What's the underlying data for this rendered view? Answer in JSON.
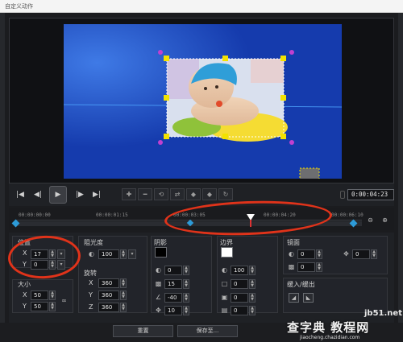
{
  "window": {
    "title": "自定义动作"
  },
  "preview": {
    "background_color": "#163fb0"
  },
  "controls": {
    "timecode": "0:00:04:23"
  },
  "timeline": {
    "ticks": [
      "00:00:00:00",
      "00:00:01:15",
      "00:00:03:05",
      "00:00:04:20",
      "00:00:06:10"
    ]
  },
  "position": {
    "label": "位置",
    "x_label": "X",
    "x_value": "17",
    "y_label": "Y",
    "y_value": "0"
  },
  "size": {
    "label": "大小",
    "x_label": "X",
    "x_value": "50",
    "y_label": "Y",
    "y_value": "50"
  },
  "opacity": {
    "label": "阻光度",
    "value": "100"
  },
  "rotation": {
    "label": "旋转",
    "x_label": "X",
    "x_value": "360",
    "y_label": "Y",
    "y_value": "360",
    "z_label": "Z",
    "z_value": "360"
  },
  "shadow": {
    "label": "阴影",
    "value1": "0",
    "value2": "15",
    "value3": "-40",
    "value4": "10"
  },
  "border": {
    "label": "边界",
    "value1": "100",
    "value2": "0",
    "value3": "0",
    "value4": "0"
  },
  "mirror": {
    "label": "镜面",
    "value1": "0",
    "value2": "0",
    "value3": "0"
  },
  "fade": {
    "label": "缓入/缓出"
  },
  "footer": {
    "reset_label": "重置",
    "save_label": "保存至..."
  },
  "watermark": {
    "site": "jb51.net",
    "brand": "查字典 教程网",
    "url": "jiaocheng.chazidian.com"
  },
  "colors": {
    "accent_yellow": "#f2e200",
    "handle_purple": "#c040d0",
    "annotation_red": "#e0331a",
    "timeline_diamond": "#2d9bd8"
  }
}
